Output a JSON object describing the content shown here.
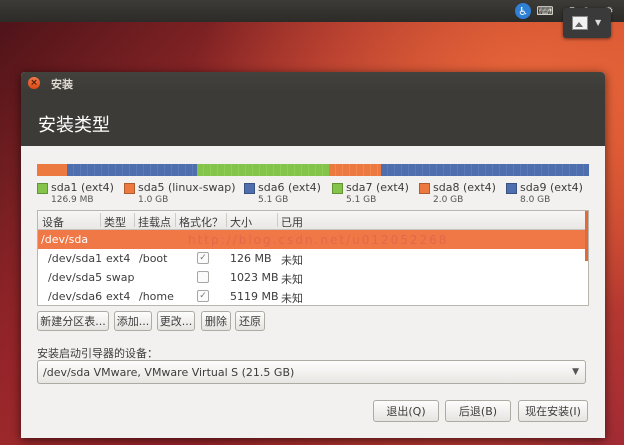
{
  "window": {
    "title": "安装",
    "header": "安装类型"
  },
  "legend": [
    {
      "name": "sda1 (ext4)",
      "size": "126.9 MB",
      "color": "#84c44a"
    },
    {
      "name": "sda5 (linux-swap)",
      "size": "1.0 GB",
      "color": "#ec7a40"
    },
    {
      "name": "sda6 (ext4)",
      "size": "5.1 GB",
      "color": "#4e6eae"
    },
    {
      "name": "sda7 (ext4)",
      "size": "5.1 GB",
      "color": "#84c44a"
    },
    {
      "name": "sda8 (ext4)",
      "size": "2.0 GB",
      "color": "#ec7a40"
    },
    {
      "name": "sda9 (ext4)",
      "size": "8.0 GB",
      "color": "#4e6eae"
    }
  ],
  "table": {
    "headers": [
      "设备",
      "类型",
      "挂载点",
      "格式化？",
      "大小",
      "已用"
    ],
    "group": "/dev/sda",
    "rows": [
      {
        "device": "/dev/sda1",
        "type": "ext4",
        "mount": "/boot",
        "format": true,
        "size": "126 MB",
        "used": "未知"
      },
      {
        "device": "/dev/sda5",
        "type": "swap",
        "mount": "",
        "format": false,
        "size": "1023 MB",
        "used": "未知"
      },
      {
        "device": "/dev/sda6",
        "type": "ext4",
        "mount": "/home",
        "format": true,
        "size": "5119 MB",
        "used": "未知"
      }
    ],
    "watermark": "http://blog.csdn.net/u012052268"
  },
  "buttons": {
    "new_table": "新建分区表...",
    "add": "添加...",
    "change": "更改...",
    "delete": "删除",
    "revert": "还原"
  },
  "bootloader": {
    "label": "安装启动引导器的设备：",
    "selected": "/dev/sda   VMware, VMware Virtual S (21.5 GB)"
  },
  "footer": {
    "quit": "退出(Q)",
    "back": "后退(B)",
    "install_now": "现在安装(I)"
  }
}
